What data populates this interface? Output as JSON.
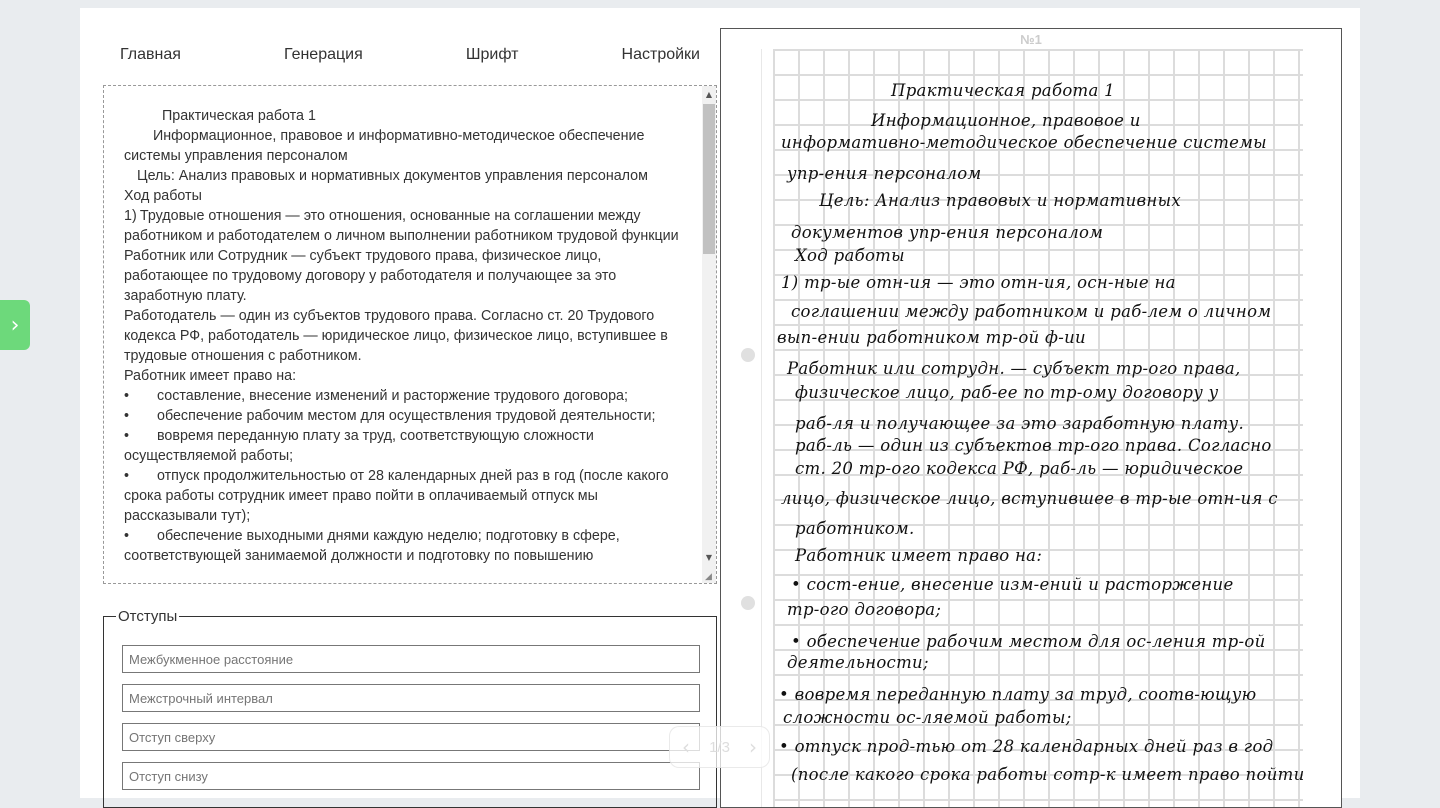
{
  "nav": {
    "items": [
      "Главная",
      "Генерация",
      "Шрифт",
      "Настройки"
    ]
  },
  "sidebar_toggle": {
    "icon": "chevron-right-icon",
    "glyph": "›",
    "color": "#6dd97b"
  },
  "editor": {
    "lines": [
      "Практическая работа 1",
      "Информационное, правовое и информативно-методическое обеспечение системы управления персоналом",
      "Цель: Анализ правовых и нормативных документов управления персоналом",
      "Ход работы",
      "1)\tТрудовые отношения — это отношения, основанные на соглашении между работником и работодателем о личном выполнении работником трудовой функции",
      "Работник или Сотрудник — субъект трудового права, физическое лицо, работающее по трудовому договору у работодателя и получающее за это заработную плату.",
      "Работодатель — один из субъектов трудового права. Согласно ст. 20 Трудового кодекса РФ, работодатель — юридическое лицо, физическое лицо, вступившее в трудовые отношения с работником.",
      "Работник имеет право на:",
      "составление, внесение изменений и расторжение трудового договора;",
      "обеспечение рабочим местом для осуществления трудовой деятельности;",
      "вовремя переданную плату за труд, соответствующую сложности осуществляемой работы;",
      "отпуск продолжительностью от 28 календарных дней раз в год (после какого срока работы сотрудник имеет право пойти в оплачиваемый отпуск мы рассказывали тут);",
      "обеспечение выходными днями каждую неделю; подготовку в сфере, соответствующей занимаемой должности и подготовку по повышению"
    ],
    "bullet": "•"
  },
  "otstupy": {
    "legend": "Отступы",
    "placeholders": [
      "Межбукменное расстояние",
      "Межстрочный интервал",
      "Отступ сверху",
      "Отступ снизу"
    ]
  },
  "preview": {
    "page_label": "№1",
    "handwriting": [
      "Практическая работа 1",
      "Информационное, правовое и",
      "информативно-методическое обеспечение системы",
      "упр-ения персоналом",
      "Цель: Анализ правовых и нормативных",
      "документов упр-ения персоналом",
      "Ход работы",
      "1) тр-ые отн-ия — это отн-ия, осн-ные на",
      "соглашении между работником и раб-лем о личном",
      "вып-ении работником тр-ой ф-ии",
      "Работник или сотрудн. — субъект тр-ого права,",
      "физическое лицо, раб-ее по тр-ому договору у",
      "раб-ля и получающее за это заработную плату.",
      "раб-ль — один из субъектов тр-ого права. Согласно",
      "ст. 20 тр-ого кодекса РФ, раб-ль — юридическое",
      "лицо, физическое лицо, вступившее в тр-ые отн-ия с",
      "работником.",
      "Работник имеет право на:",
      "• сост-ение, внесение изм-ений и расторжение",
      "тр-ого договора;",
      "• обеспечение рабочим местом для ос-ления тр-ой",
      "деятельности;",
      "• вовремя переданную плату за труд, соотв-ющую",
      "сложности ос-ляемой работы;",
      "• отпуск прод-тью от 28 календарных дней раз в год",
      "(после какого срока работы сотр-к имеет право пойти"
    ]
  },
  "pager": {
    "prev_icon": "chevron-left-icon",
    "next_icon": "chevron-right-icon",
    "label": "1/3",
    "prev": "‹",
    "next": "›"
  }
}
